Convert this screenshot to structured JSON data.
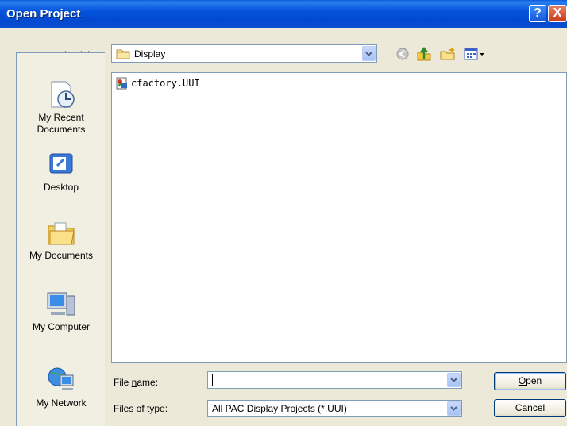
{
  "window": {
    "title": "Open Project"
  },
  "title_buttons": {
    "help": "?",
    "close": "X"
  },
  "look_in": {
    "label_pre": "Look ",
    "label_ul": "i",
    "label_post": "n:",
    "value": "Display"
  },
  "toolbar": {
    "back_icon": "back-arrow-icon",
    "up_icon": "up-folder-icon",
    "new_folder_icon": "new-folder-icon",
    "views_icon": "views-menu-icon"
  },
  "places": [
    {
      "label": "My Recent Documents",
      "icon": "recent-documents-icon"
    },
    {
      "label": "Desktop",
      "icon": "desktop-icon"
    },
    {
      "label": "My Documents",
      "icon": "my-documents-icon"
    },
    {
      "label": "My Computer",
      "icon": "my-computer-icon"
    },
    {
      "label": "My Network",
      "icon": "my-network-icon"
    }
  ],
  "files": [
    {
      "name": "cfactory.UUI",
      "icon": "uui-project-icon"
    }
  ],
  "file_name": {
    "label_pre": "File ",
    "label_ul": "n",
    "label_post": "ame:",
    "value": ""
  },
  "file_type": {
    "label_pre": "Files of ",
    "label_ul": "t",
    "label_post": "ype:",
    "value": "All PAC Display Projects (*.UUI)"
  },
  "buttons": {
    "open_ul": "O",
    "open_rest": "pen",
    "cancel": "Cancel"
  },
  "colors": {
    "title_bar": "#0553dc",
    "dialog_bg": "#ece9d8",
    "border": "#7f9db9"
  }
}
